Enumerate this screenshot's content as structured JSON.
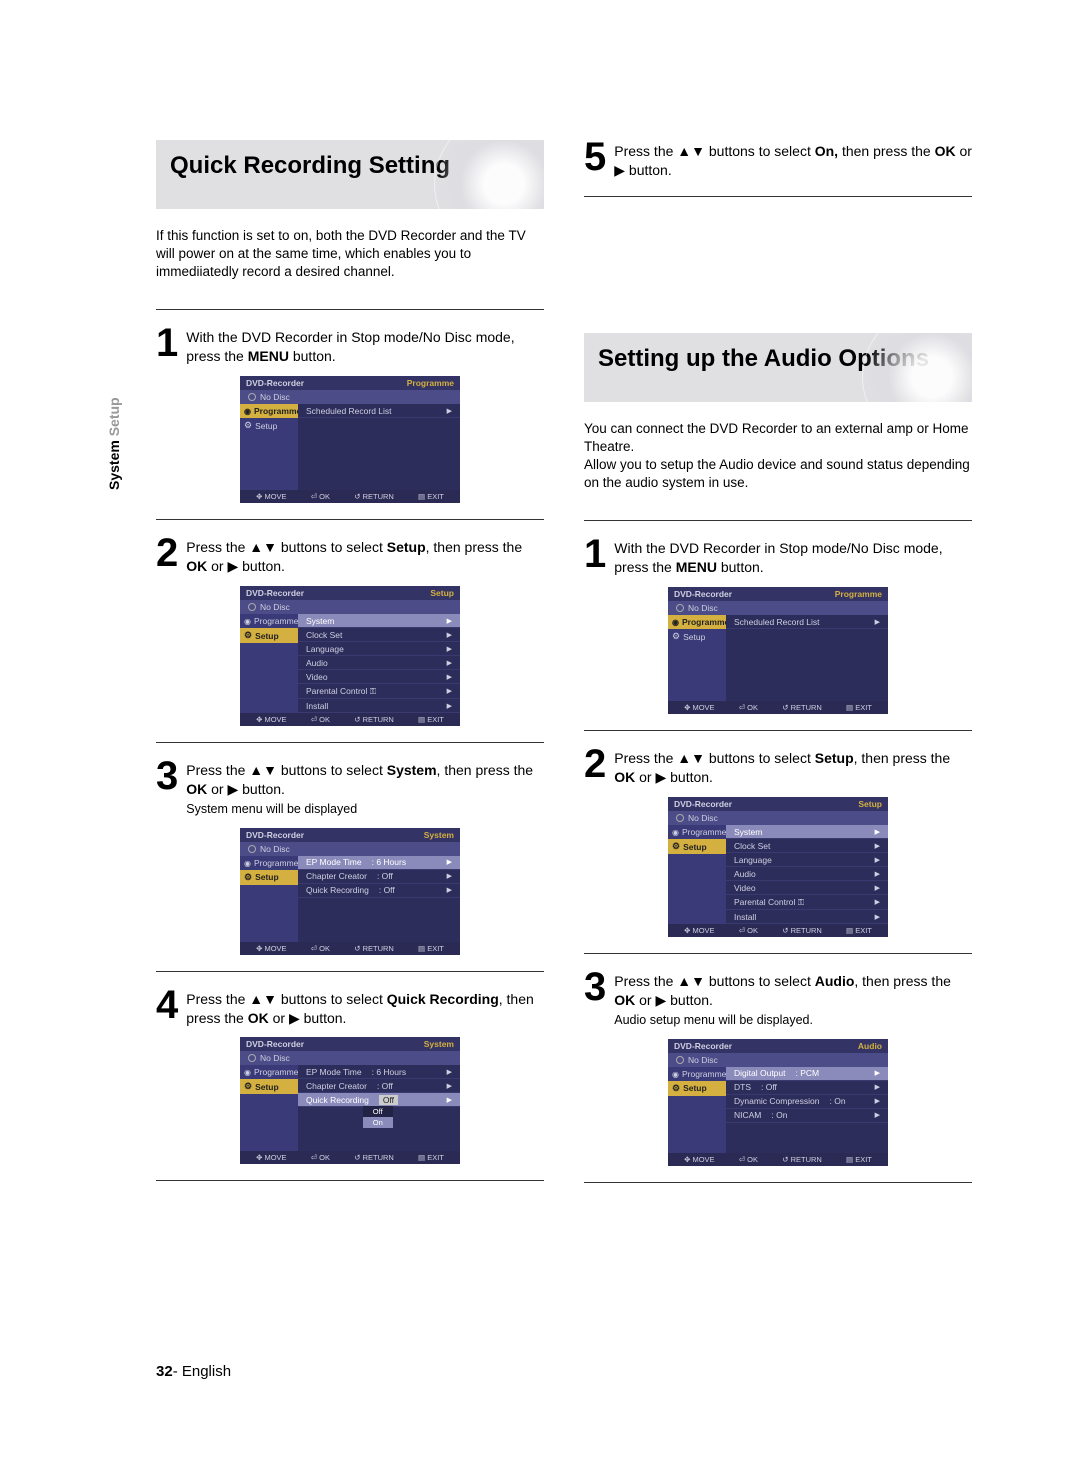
{
  "vert_label": {
    "main": "System",
    "light": "Setup"
  },
  "page_footer": {
    "num": "32",
    "sep": "- ",
    "lang": "English"
  },
  "left": {
    "heading": "Quick Recording Setting",
    "intro": "If this function is set to on, both the DVD Recorder and the TV will power on at the same time, which enables you to immediiatedly record a desired channel.",
    "s1": {
      "pre": "With the DVD Recorder in Stop mode/No Disc mode, press the ",
      "b": "MENU",
      "post": " button."
    },
    "s2": {
      "pre": "Press the ▲▼ buttons to select ",
      "b": "Setup",
      "mid": ", then press the ",
      "b2": "OK",
      "post": " or ▶ button."
    },
    "s3": {
      "pre": "Press the ▲▼ buttons to select ",
      "b": "System",
      "mid": ", then press the ",
      "b2": "OK",
      "post": " or ▶ button.",
      "note": "System menu will be displayed"
    },
    "s4": {
      "pre": "Press the ▲▼ buttons to select ",
      "b": "Quick Recording",
      "mid": ", then press the ",
      "b2": "OK",
      "post": " or ▶ button."
    }
  },
  "right": {
    "s5": {
      "pre": "Press the ▲▼ buttons to select ",
      "b": "On,",
      "mid": " then press the ",
      "b2": "OK",
      "post": " or ▶ button."
    },
    "heading": "Setting up the Audio Options",
    "intro": "You can connect the DVD Recorder to an external amp or Home Theatre.\nAllow you to setup the Audio device and sound status depending on the audio system in use.",
    "s1": {
      "pre": "With the DVD Recorder in Stop mode/No Disc mode, press the ",
      "b": "MENU",
      "post": " button."
    },
    "s2": {
      "pre": "Press the ▲▼ buttons to select ",
      "b": "Setup",
      "mid": ", then press the ",
      "b2": "OK",
      "post": " or ▶ button."
    },
    "s3": {
      "pre": "Press the ▲▼ buttons to select ",
      "b": "Audio",
      "mid": ", then press the ",
      "b2": "OK",
      "post": " or ▶ button.",
      "note": "Audio setup menu will be displayed."
    }
  },
  "osd": {
    "device": "DVD-Recorder",
    "nodisc": "No Disc",
    "sidebar": {
      "programme": "Programme",
      "setup": "Setup"
    },
    "footer": {
      "move": "MOVE",
      "ok": "OK",
      "return": "RETURN",
      "exit": "EXIT"
    },
    "prog_title": "Programme",
    "setup_title": "Setup",
    "system_title": "System",
    "audio_title": "Audio",
    "scheduled": "Scheduled Record List",
    "setup_items": [
      "System",
      "Clock Set",
      "Language",
      "Audio",
      "Video",
      "Parental Control ⚿",
      "Install"
    ],
    "system_items": [
      {
        "l": "EP Mode Time",
        "v": ": 6 Hours"
      },
      {
        "l": "Chapter Creator",
        "v": ": Off"
      },
      {
        "l": "Quick Recording",
        "v": ": Off"
      }
    ],
    "qr_options": [
      "Off",
      "On"
    ],
    "audio_items": [
      {
        "l": "Digital Output",
        "v": ": PCM"
      },
      {
        "l": "DTS",
        "v": ": Off"
      },
      {
        "l": "Dynamic Compression",
        "v": ": On"
      },
      {
        "l": "NICAM",
        "v": ": On"
      }
    ]
  }
}
